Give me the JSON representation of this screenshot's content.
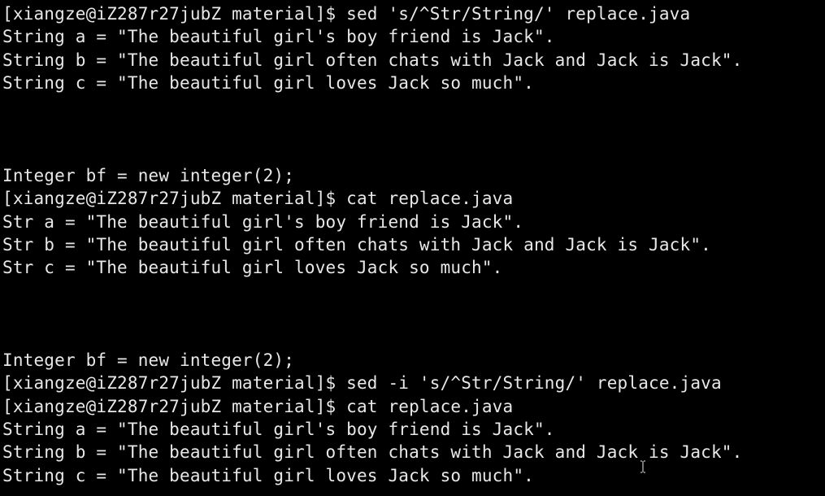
{
  "terminal": {
    "lines": [
      "[xiangze@iZ287r27jubZ material]$ sed 's/^Str/String/' replace.java",
      "String a = \"The beautiful girl's boy friend is Jack\".",
      "String b = \"The beautiful girl often chats with Jack and Jack is Jack\".",
      "String c = \"The beautiful girl loves Jack so much\".",
      "",
      "",
      "",
      "Integer bf = new integer(2);",
      "[xiangze@iZ287r27jubZ material]$ cat replace.java",
      "Str a = \"The beautiful girl's boy friend is Jack\".",
      "Str b = \"The beautiful girl often chats with Jack and Jack is Jack\".",
      "Str c = \"The beautiful girl loves Jack so much\".",
      "",
      "",
      "",
      "Integer bf = new integer(2);",
      "[xiangze@iZ287r27jubZ material]$ sed -i 's/^Str/String/' replace.java",
      "[xiangze@iZ287r27jubZ material]$ cat replace.java",
      "String a = \"The beautiful girl's boy friend is Jack\".",
      "String b = \"The beautiful girl often chats with Jack and Jack is Jack\".",
      "String c = \"The beautiful girl loves Jack so much\"."
    ],
    "cursor_icon": "text-cursor-icon",
    "colors": {
      "background": "#000000",
      "foreground": "#e8e8e8"
    }
  }
}
